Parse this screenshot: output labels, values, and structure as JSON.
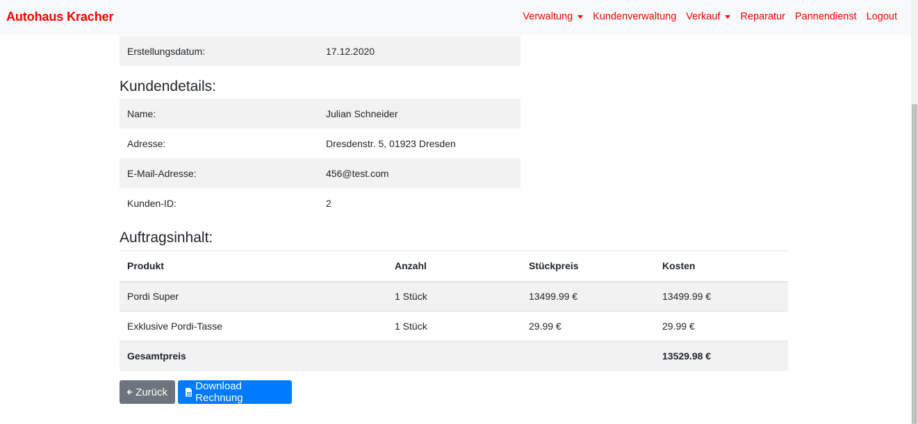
{
  "navbar": {
    "brand": "Autohaus Kracher",
    "items": [
      {
        "label": "Verwaltung",
        "dropdown": true
      },
      {
        "label": "Kundenverwaltung",
        "dropdown": false
      },
      {
        "label": "Verkauf",
        "dropdown": true
      },
      {
        "label": "Reparatur",
        "dropdown": false
      },
      {
        "label": "Pannendienst",
        "dropdown": false
      },
      {
        "label": "Logout",
        "dropdown": false
      }
    ]
  },
  "order_info": {
    "created_label": "Erstellungsdatum:",
    "created_value": "17.12.2020"
  },
  "customer": {
    "heading": "Kundendetails:",
    "rows": [
      {
        "label": "Name:",
        "value": "Julian Schneider"
      },
      {
        "label": "Adresse:",
        "value": "Dresdenstr. 5, 01923 Dresden"
      },
      {
        "label": "E-Mail-Adresse:",
        "value": "456@test.com"
      },
      {
        "label": "Kunden-ID:",
        "value": "2"
      }
    ]
  },
  "order": {
    "heading": "Auftragsinhalt:",
    "columns": [
      "Produkt",
      "Anzahl",
      "Stückpreis",
      "Kosten"
    ],
    "items": [
      {
        "product": "Pordi Super",
        "quantity": "1 Stück",
        "unit_price": "13499.99 €",
        "cost": "13499.99 €"
      },
      {
        "product": "Exklusive Pordi-Tasse",
        "quantity": "1 Stück",
        "unit_price": "29.99 €",
        "cost": "29.99 €"
      }
    ],
    "total_label": "Gesamtpreis",
    "total_value": "13529.98 €"
  },
  "actions": {
    "back_label": "Zurück",
    "download_label": "Download Rechnung"
  },
  "colors": {
    "brand": "#ff0000",
    "back_button": "#6c757d",
    "download_button": "#007bff",
    "stripe": "#f2f2f2"
  },
  "icons": {
    "back": "arrow-left-icon",
    "download": "file-icon",
    "dropdown": "caret-down-icon"
  }
}
